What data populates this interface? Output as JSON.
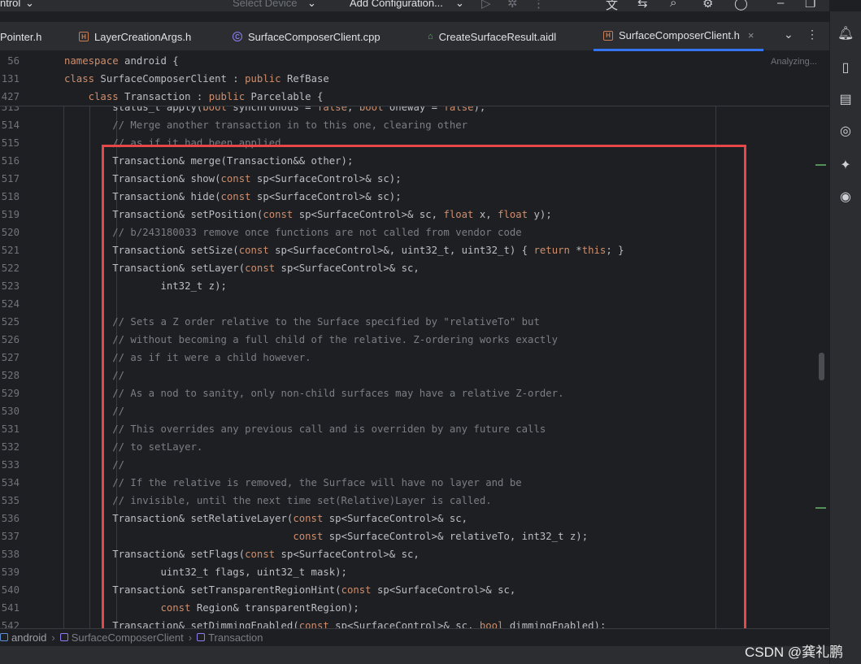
{
  "toolbar": {
    "left_text": "ntrol",
    "device": "Select Device",
    "config": "Add Configuration..."
  },
  "tabs": [
    {
      "label": "Pointer.h",
      "icon": "header-file-icon"
    },
    {
      "label": "LayerCreationArgs.h",
      "icon": "header-file-icon"
    },
    {
      "label": "SurfaceComposerClient.cpp",
      "icon": "cpp-file-icon"
    },
    {
      "label": "CreateSurfaceResult.aidl",
      "icon": "aidl-file-icon"
    },
    {
      "label": "SurfaceComposerClient.h",
      "icon": "header-file-icon",
      "active": true,
      "close": "×"
    }
  ],
  "status": {
    "analyzing": "Analyzing..."
  },
  "sticky_lines": [
    {
      "ln": "56",
      "parts": [
        {
          "t": "namespace",
          "c": "kw"
        },
        {
          "t": " android {",
          "c": ""
        }
      ]
    },
    {
      "ln": "131",
      "parts": [
        {
          "t": "class",
          "c": "kw"
        },
        {
          "t": " SurfaceComposerClient : ",
          "c": ""
        },
        {
          "t": "public",
          "c": "kw"
        },
        {
          "t": " RefBase",
          "c": ""
        }
      ]
    },
    {
      "ln": "427",
      "parts": [
        {
          "t": "    ",
          "c": ""
        },
        {
          "t": "class",
          "c": "kw"
        },
        {
          "t": " Transaction : ",
          "c": ""
        },
        {
          "t": "public",
          "c": "kw"
        },
        {
          "t": " Parcelable {",
          "c": ""
        }
      ]
    }
  ],
  "code_lines": [
    {
      "ln": "513",
      "parts": [
        {
          "t": "        status_t apply(",
          "c": ""
        },
        {
          "t": "bool",
          "c": "kw"
        },
        {
          "t": " synchronous = ",
          "c": ""
        },
        {
          "t": "false",
          "c": "kw"
        },
        {
          "t": ", ",
          "c": ""
        },
        {
          "t": "bool",
          "c": "kw"
        },
        {
          "t": " oneway = ",
          "c": ""
        },
        {
          "t": "false",
          "c": "kw"
        },
        {
          "t": ");",
          "c": ""
        }
      ]
    },
    {
      "ln": "514",
      "parts": [
        {
          "t": "        // Merge another transaction in to this one, clearing other",
          "c": "cm"
        }
      ]
    },
    {
      "ln": "515",
      "parts": [
        {
          "t": "        // as if it had been applied.",
          "c": "cm"
        }
      ]
    },
    {
      "ln": "516",
      "parts": [
        {
          "t": "        Transaction& merge(Transaction&& other);",
          "c": ""
        }
      ]
    },
    {
      "ln": "517",
      "parts": [
        {
          "t": "        Transaction& show(",
          "c": ""
        },
        {
          "t": "const",
          "c": "kw"
        },
        {
          "t": " sp<SurfaceControl>& sc);",
          "c": ""
        }
      ]
    },
    {
      "ln": "518",
      "parts": [
        {
          "t": "        Transaction& hide(",
          "c": ""
        },
        {
          "t": "const",
          "c": "kw"
        },
        {
          "t": " sp<SurfaceControl>& sc);",
          "c": ""
        }
      ]
    },
    {
      "ln": "519",
      "parts": [
        {
          "t": "        Transaction& setPosition(",
          "c": ""
        },
        {
          "t": "const",
          "c": "kw"
        },
        {
          "t": " sp<SurfaceControl>& sc, ",
          "c": ""
        },
        {
          "t": "float",
          "c": "kw"
        },
        {
          "t": " x, ",
          "c": ""
        },
        {
          "t": "float",
          "c": "kw"
        },
        {
          "t": " y);",
          "c": ""
        }
      ]
    },
    {
      "ln": "520",
      "parts": [
        {
          "t": "        // b/243180033 remove once functions are not called from vendor code",
          "c": "cm"
        }
      ]
    },
    {
      "ln": "521",
      "parts": [
        {
          "t": "        Transaction& setSize(",
          "c": ""
        },
        {
          "t": "const",
          "c": "kw"
        },
        {
          "t": " sp<SurfaceControl>&, uint32_t, uint32_t) { ",
          "c": ""
        },
        {
          "t": "return",
          "c": "kw"
        },
        {
          "t": " *",
          "c": ""
        },
        {
          "t": "this",
          "c": "kw"
        },
        {
          "t": "; }",
          "c": ""
        }
      ]
    },
    {
      "ln": "522",
      "parts": [
        {
          "t": "        Transaction& setLayer(",
          "c": ""
        },
        {
          "t": "const",
          "c": "kw"
        },
        {
          "t": " sp<SurfaceControl>& sc,",
          "c": ""
        }
      ]
    },
    {
      "ln": "523",
      "parts": [
        {
          "t": "                int32_t z);",
          "c": ""
        }
      ]
    },
    {
      "ln": "524",
      "parts": [
        {
          "t": "",
          "c": ""
        }
      ]
    },
    {
      "ln": "525",
      "parts": [
        {
          "t": "        // Sets a Z order relative to the Surface specified by \"relativeTo\" but",
          "c": "cm"
        }
      ]
    },
    {
      "ln": "526",
      "parts": [
        {
          "t": "        // without becoming a full child of the relative. Z-ordering works exactly",
          "c": "cm"
        }
      ]
    },
    {
      "ln": "527",
      "parts": [
        {
          "t": "        // as if it were a child however.",
          "c": "cm"
        }
      ]
    },
    {
      "ln": "528",
      "parts": [
        {
          "t": "        //",
          "c": "cm"
        }
      ]
    },
    {
      "ln": "529",
      "parts": [
        {
          "t": "        // As a nod to sanity, only non-child surfaces may have a relative Z-order.",
          "c": "cm"
        }
      ]
    },
    {
      "ln": "530",
      "parts": [
        {
          "t": "        //",
          "c": "cm"
        }
      ]
    },
    {
      "ln": "531",
      "parts": [
        {
          "t": "        // This overrides any previous call and is overriden by any future calls",
          "c": "cm"
        }
      ]
    },
    {
      "ln": "532",
      "parts": [
        {
          "t": "        // to setLayer.",
          "c": "cm"
        }
      ]
    },
    {
      "ln": "533",
      "parts": [
        {
          "t": "        //",
          "c": "cm"
        }
      ]
    },
    {
      "ln": "534",
      "parts": [
        {
          "t": "        // If the relative is removed, the Surface will have no layer and be",
          "c": "cm"
        }
      ]
    },
    {
      "ln": "535",
      "parts": [
        {
          "t": "        // invisible, until the next time set(Relative)Layer is called.",
          "c": "cm"
        }
      ]
    },
    {
      "ln": "536",
      "parts": [
        {
          "t": "        Transaction& setRelativeLayer(",
          "c": ""
        },
        {
          "t": "const",
          "c": "kw"
        },
        {
          "t": " sp<SurfaceControl>& sc,",
          "c": ""
        }
      ]
    },
    {
      "ln": "537",
      "parts": [
        {
          "t": "                                      ",
          "c": ""
        },
        {
          "t": "const",
          "c": "kw"
        },
        {
          "t": " sp<SurfaceControl>& relativeTo, int32_t z);",
          "c": ""
        }
      ]
    },
    {
      "ln": "538",
      "parts": [
        {
          "t": "        Transaction& setFlags(",
          "c": ""
        },
        {
          "t": "const",
          "c": "kw"
        },
        {
          "t": " sp<SurfaceControl>& sc,",
          "c": ""
        }
      ]
    },
    {
      "ln": "539",
      "parts": [
        {
          "t": "                uint32_t flags, uint32_t mask);",
          "c": ""
        }
      ]
    },
    {
      "ln": "540",
      "parts": [
        {
          "t": "        Transaction& setTransparentRegionHint(",
          "c": ""
        },
        {
          "t": "const",
          "c": "kw"
        },
        {
          "t": " sp<SurfaceControl>& sc,",
          "c": ""
        }
      ]
    },
    {
      "ln": "541",
      "parts": [
        {
          "t": "                ",
          "c": ""
        },
        {
          "t": "const",
          "c": "kw"
        },
        {
          "t": " Region& transparentRegion);",
          "c": ""
        }
      ]
    },
    {
      "ln": "542",
      "parts": [
        {
          "t": "        Transaction& setDimmingEnabled(",
          "c": ""
        },
        {
          "t": "const",
          "c": "kw"
        },
        {
          "t": " sp<SurfaceControl>& sc, ",
          "c": ""
        },
        {
          "t": "bool",
          "c": "kw"
        },
        {
          "t": " dimmingEnabled);",
          "c": ""
        }
      ]
    }
  ],
  "breadcrumbs": [
    "android",
    "SurfaceComposerClient",
    "Transaction"
  ],
  "watermark": "CSDN @龚礼鹏",
  "colors": {
    "highlight": "#e8474a",
    "keyword": "#cf8e6d",
    "comment": "#7a7e85",
    "active_tab": "#3574f0"
  }
}
